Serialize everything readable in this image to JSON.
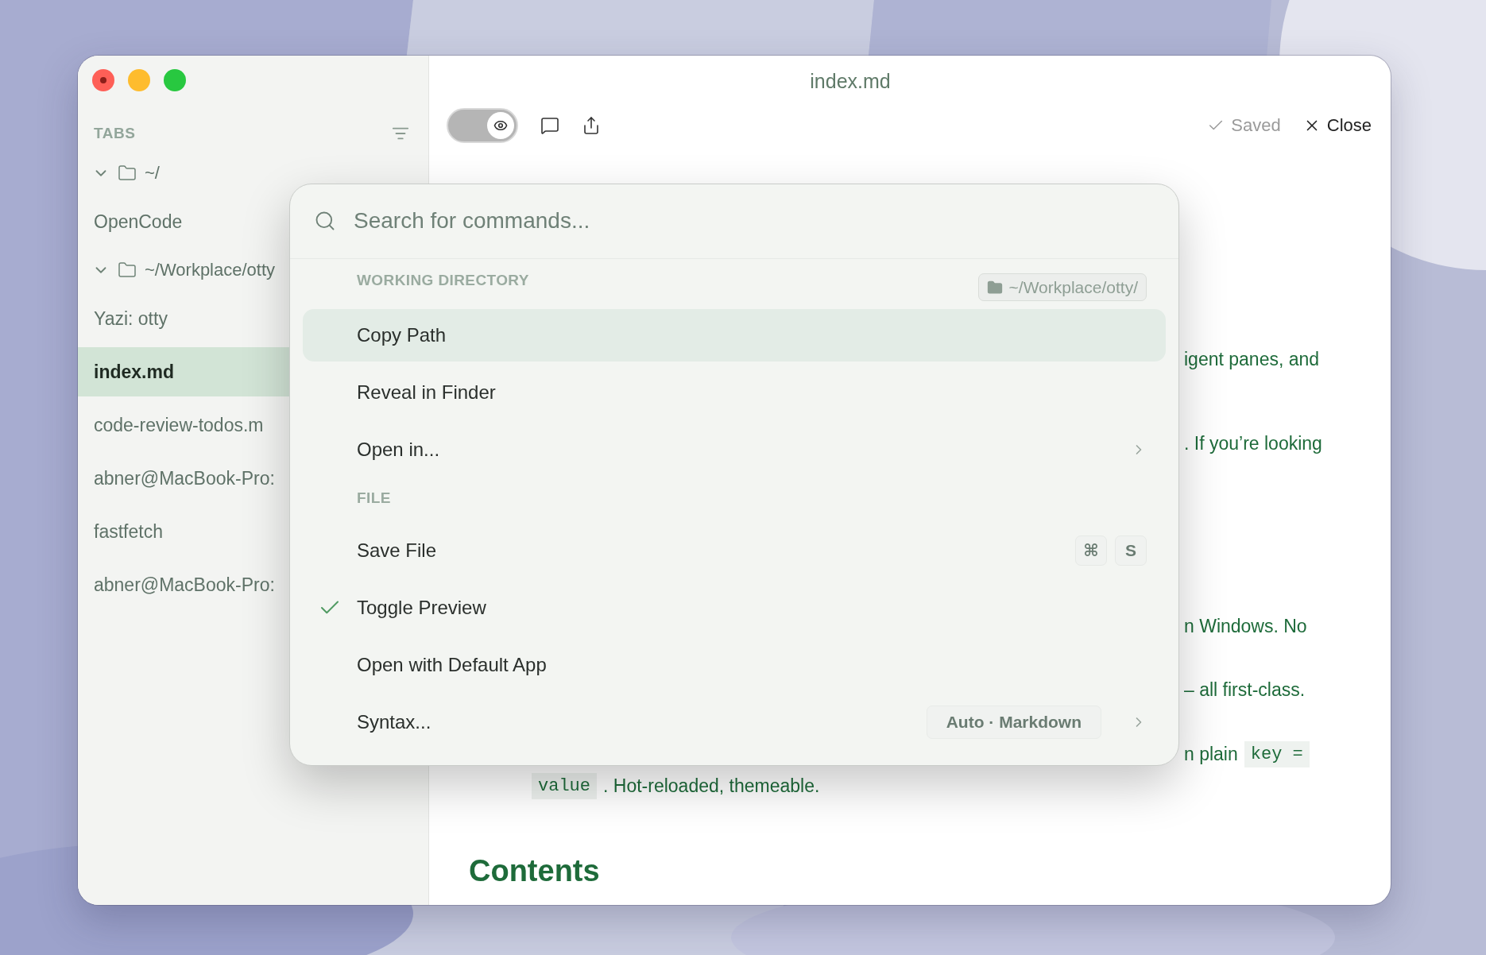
{
  "window": {
    "title": "index.md"
  },
  "sidebar": {
    "heading": "TABS",
    "groups": [
      {
        "label": "~/",
        "expanded": true,
        "children": [
          {
            "label": "OpenCode",
            "selected": false
          }
        ]
      },
      {
        "label": "~/Workplace/otty",
        "expanded": true,
        "children": [
          {
            "label": "Yazi: otty",
            "selected": false
          },
          {
            "label": "index.md",
            "selected": true
          },
          {
            "label": "code-review-todos.m",
            "selected": false
          },
          {
            "label": "abner@MacBook-Pro:",
            "selected": false
          },
          {
            "label": "fastfetch",
            "selected": false
          },
          {
            "label": "abner@MacBook-Pro:",
            "selected": false
          }
        ]
      }
    ]
  },
  "toolbar": {
    "preview_toggle": {
      "on": true
    },
    "status": "Saved",
    "close": "Close"
  },
  "document": {
    "lines": [
      {
        "segments": [
          {
            "kind": "text",
            "text": "igent panes, and"
          }
        ]
      },
      {
        "segments": [
          {
            "kind": "text",
            "text": ". If you’re looking"
          }
        ]
      },
      {
        "segments": [
          {
            "kind": "text",
            "text": "n Windows. No"
          }
        ]
      },
      {
        "segments": [
          {
            "kind": "text",
            "text": "– all first-class."
          }
        ]
      },
      {
        "segments": [
          {
            "kind": "text",
            "text": "n plain"
          },
          {
            "kind": "code",
            "text": "key ="
          }
        ]
      },
      {
        "segments": [
          {
            "kind": "code",
            "text": "value"
          },
          {
            "kind": "text",
            "text": ". Hot-reloaded, themeable."
          }
        ]
      }
    ],
    "heading": "Contents"
  },
  "palette": {
    "search": {
      "placeholder": "Search for commands..."
    },
    "sections": [
      {
        "heading": "WORKING DIRECTORY",
        "badge": "~/Workplace/otty/",
        "items": [
          {
            "label": "Copy Path",
            "selected": true,
            "checked": false,
            "submenu": false
          },
          {
            "label": "Reveal in Finder",
            "selected": false,
            "checked": false,
            "submenu": false
          },
          {
            "label": "Open in...",
            "selected": false,
            "checked": false,
            "submenu": true
          }
        ]
      },
      {
        "heading": "FILE",
        "items": [
          {
            "label": "Save File",
            "selected": false,
            "checked": false,
            "submenu": false,
            "shortcut": [
              "⌘",
              "S"
            ]
          },
          {
            "label": "Toggle Preview",
            "selected": false,
            "checked": true,
            "submenu": false
          },
          {
            "label": "Open with Default App",
            "selected": false,
            "checked": false,
            "submenu": false
          },
          {
            "label": "Syntax...",
            "selected": false,
            "checked": false,
            "submenu": true,
            "value": "Auto · Markdown"
          }
        ]
      }
    ]
  }
}
